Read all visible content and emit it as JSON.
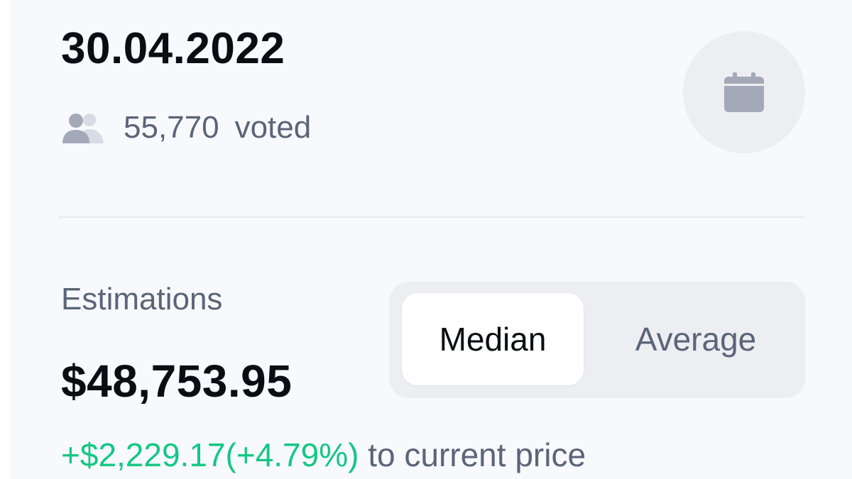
{
  "header": {
    "date": "30.04.2022",
    "voted_count": "55,770",
    "voted_label": "voted"
  },
  "icons": {
    "users": "users-icon",
    "calendar": "calendar-icon"
  },
  "estimations": {
    "label": "Estimations",
    "toggle": {
      "options": [
        "Median",
        "Average"
      ],
      "selected": "Median"
    },
    "value": "$48,753.95",
    "change_amount": "+$2,229.17",
    "change_percent": "(+4.79%)",
    "change_suffix": "to current price"
  },
  "colors": {
    "positive": "#16c784",
    "muted_text": "#5b6478",
    "primary_text": "#0b0d12",
    "card_bg": "#f7f9fc",
    "icon_gray": "#a3a9b8"
  }
}
